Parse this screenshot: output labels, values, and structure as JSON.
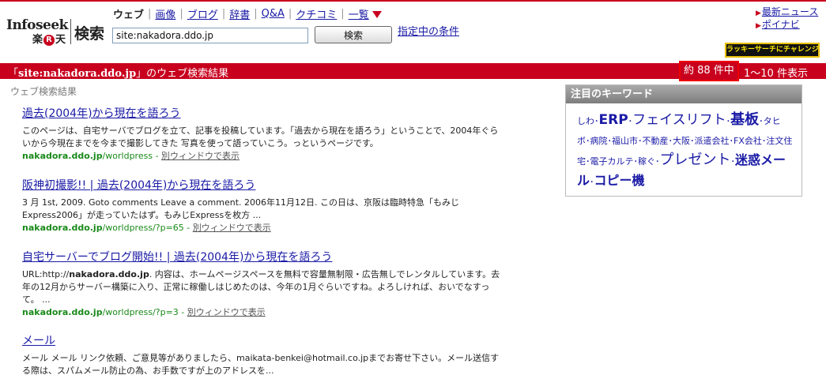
{
  "header": {
    "logo": {
      "infoseek": "Infoseek",
      "rakuten_left": "楽",
      "rakuten_r": "R",
      "rakuten_right": "天",
      "kensaku": "検索"
    },
    "tabs": [
      {
        "label": "ウェブ",
        "current": true
      },
      {
        "label": "画像"
      },
      {
        "label": "ブログ"
      },
      {
        "label": "辞書"
      },
      {
        "label": "Q&A"
      },
      {
        "label": "クチコミ"
      },
      {
        "label": "一覧"
      }
    ],
    "tab_separator": "|",
    "search": {
      "value": "site:nakadora.ddo.jp",
      "button_label": "検索"
    },
    "conditions_link": "指定中の条件",
    "right_links": [
      "最新ニュース",
      "ポイナビ"
    ],
    "lucky_button": "ラッキーサーチにチャレンジ"
  },
  "bar": {
    "query_open": "「",
    "query": "site:nakadora.ddo.jp",
    "query_close": "」",
    "query_suffix": "のウェブ検索結果",
    "count_text": "約 88 件中",
    "range_text": "1〜10 件表示"
  },
  "section_label": "ウェブ検索結果",
  "results": [
    {
      "title": "過去(2004年)から現在を語ろう",
      "snippet": "このページは、自宅サーバでブログを立て、記事を投稿しています。「過去から現在を語ろう」ということで、2004年ぐらいから今現在までを今まで撮影してきた 写真を使って語っていこう。っというページです。",
      "url_host": "nakadora.ddo.jp",
      "url_path": "/worldpress",
      "sep": " - ",
      "new_window": "別ウィンドウで表示"
    },
    {
      "title": "阪神初撮影!! | 過去(2004年)から現在を語ろう",
      "snippet": "3 月 1st, 2009. Goto comments Leave a comment. 2006年11月12日. この日は、京阪は臨時特急「もみじExpress2006」が走っていたはず。もみじExpressを枚方 ...",
      "url_host": "nakadora.ddo.jp",
      "url_path": "/worldpress/?p=65",
      "sep": " - ",
      "new_window": "別ウィンドウで表示"
    },
    {
      "title": "自宅サーバーでブログ開始!! | 過去(2004年)から現在を語ろう",
      "snippet_prefix": "URL:http://",
      "snippet_bold": "nakadora.ddo.jp",
      "snippet": ". 内容は、ホームページスペースを無料で容量無制限・広告無しでレンタルしています。去年の12月からサーバー構築に入り、正常に稼働しはじめたのは、今年の1月ぐらいですね。よろしければ、おいでなすって。 ...",
      "url_host": "nakadora.ddo.jp",
      "url_path": "/worldpress/?p=3",
      "sep": " - ",
      "new_window": "別ウィンドウで表示"
    },
    {
      "title": "メール",
      "snippet": "メール メール リンク依頼、ご意見等がありましたら、maikata-benkei@hotmail.co.jpまでお寄せ下さい。メール送信する際は、スパムメール防止の為、お手数ですが上のアドレスを..."
    }
  ],
  "keywords": {
    "title": "注目のキーワード",
    "separator": "･",
    "items": [
      {
        "text": "しわ",
        "size": "s1"
      },
      {
        "text": "ERP",
        "size": "s4",
        "bold": true
      },
      {
        "text": "フェイスリフト",
        "size": "s4"
      },
      {
        "text": "基板",
        "size": "s5",
        "bold": true
      },
      {
        "text": "タヒボ",
        "size": "s1"
      },
      {
        "text": "病院",
        "size": "s1"
      },
      {
        "text": "福山市",
        "size": "s1"
      },
      {
        "text": "不動産",
        "size": "s1"
      },
      {
        "text": "大阪",
        "size": "s1"
      },
      {
        "text": "派遣会社",
        "size": "s1"
      },
      {
        "text": "FX会社",
        "size": "s1"
      },
      {
        "text": "注文住宅",
        "size": "s1"
      },
      {
        "text": "電子カルテ",
        "size": "s1"
      },
      {
        "text": "稼ぐ",
        "size": "s1"
      },
      {
        "text": "プレゼント",
        "size": "s5"
      },
      {
        "text": "迷惑メール",
        "size": "s3",
        "bold": true
      },
      {
        "text": "コピー機",
        "size": "s3",
        "bold": true
      }
    ]
  }
}
